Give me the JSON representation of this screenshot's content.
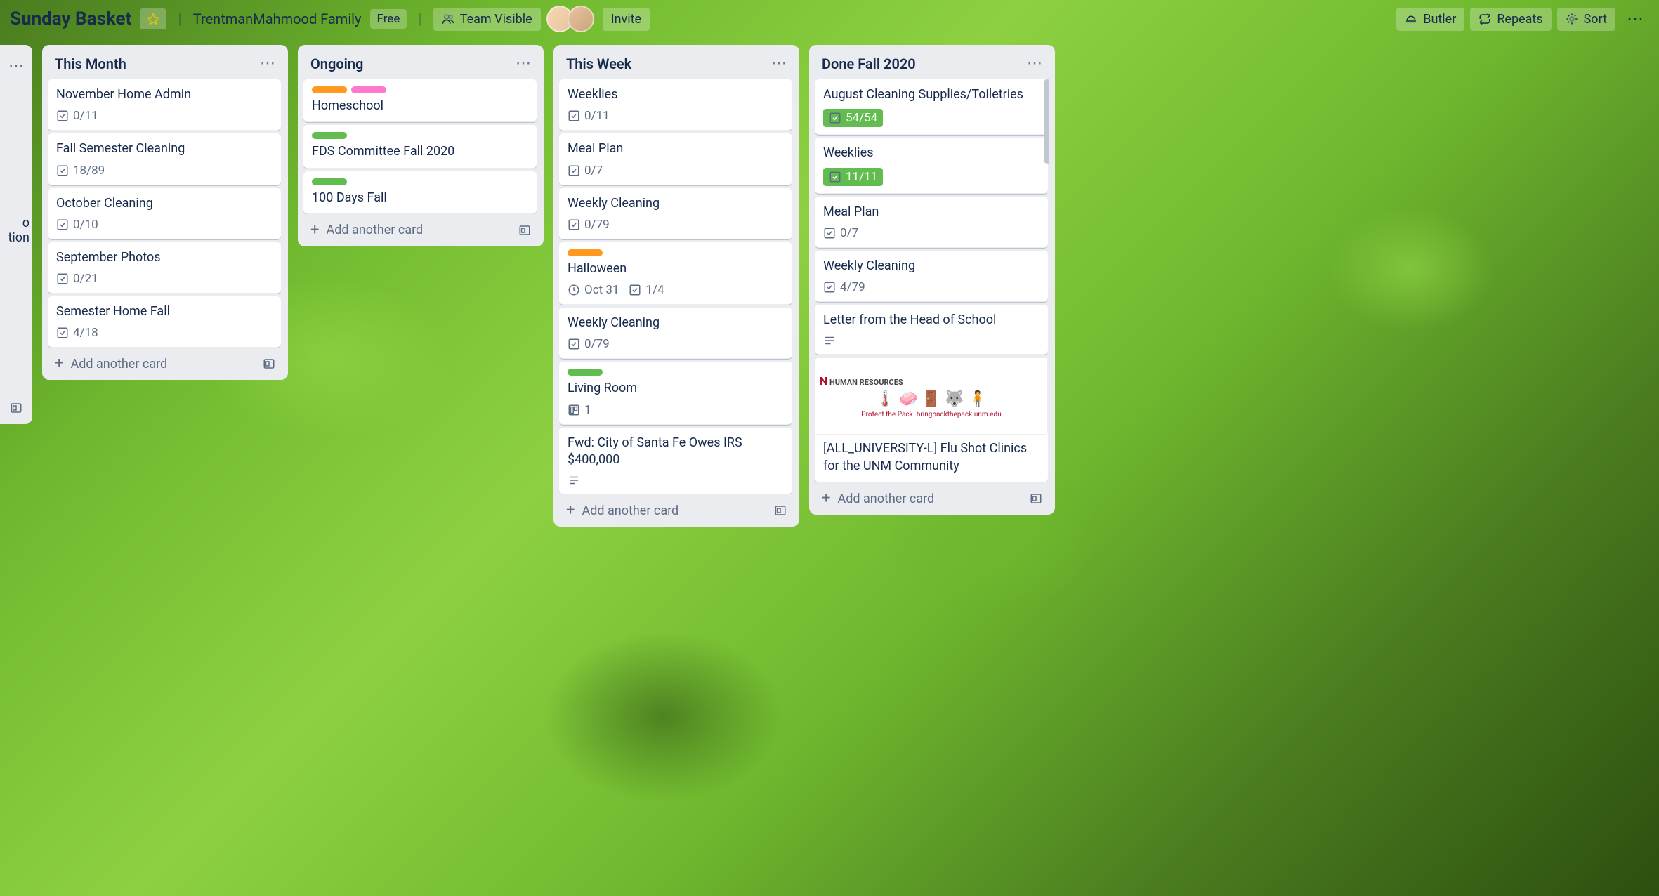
{
  "header": {
    "board_name": "Sunday Basket",
    "team": "TrentmanMahmood Family",
    "plan_badge": "Free",
    "visibility": "Team Visible",
    "invite": "Invite",
    "butler": "Butler",
    "repeats": "Repeats",
    "sort": "Sort"
  },
  "peek_list": {
    "text_line1": "o",
    "text_line2": "tion"
  },
  "lists": [
    {
      "title": "This Month",
      "cards": [
        {
          "title": "November Home Admin",
          "checklist": "0/11"
        },
        {
          "title": "Fall Semester Cleaning",
          "checklist": "18/89"
        },
        {
          "title": "October Cleaning",
          "checklist": "0/10"
        },
        {
          "title": "September Photos",
          "checklist": "0/21"
        },
        {
          "title": "Semester Home Fall",
          "checklist": "4/18"
        }
      ],
      "add": "Add another card"
    },
    {
      "title": "Ongoing",
      "cards": [
        {
          "title": "Homeschool",
          "labels": [
            "orange",
            "pink"
          ]
        },
        {
          "title": "FDS Committee Fall 2020",
          "labels": [
            "green"
          ]
        },
        {
          "title": "100 Days Fall",
          "labels": [
            "green"
          ]
        }
      ],
      "add": "Add another card"
    },
    {
      "title": "This Week",
      "cards": [
        {
          "title": "Weeklies",
          "checklist": "0/11"
        },
        {
          "title": "Meal Plan",
          "checklist": "0/7"
        },
        {
          "title": "Weekly Cleaning",
          "checklist": "0/79"
        },
        {
          "title": "Halloween",
          "labels": [
            "orange"
          ],
          "due": "Oct 31",
          "checklist": "1/4"
        },
        {
          "title": "Weekly Cleaning",
          "checklist": "0/79"
        },
        {
          "title": "Living Room",
          "labels": [
            "green"
          ],
          "trello_count": "1"
        },
        {
          "title": "Fwd: City of Santa Fe Owes IRS $400,000",
          "has_desc": true
        }
      ],
      "add": "Add another card"
    },
    {
      "title": "Done Fall 2020",
      "cards": [
        {
          "title": "August Cleaning Supplies/Toiletries",
          "checklist": "54/54",
          "done": true
        },
        {
          "title": "Weeklies",
          "checklist": "11/11",
          "done": true
        },
        {
          "title": "Meal Plan",
          "checklist": "0/7"
        },
        {
          "title": "Weekly Cleaning",
          "checklist": "4/79"
        },
        {
          "title": "Letter from the Head of School",
          "has_desc": true
        },
        {
          "title": "[ALL_UNIVERSITY-L] Flu Shot Clinics for the UNM Community",
          "cover": true,
          "cover_text_top": "HUMAN RESOURCES",
          "cover_text_bottom": "Protect the Pack. bringbackthepack.unm.edu"
        }
      ],
      "add": "Add another card"
    }
  ]
}
